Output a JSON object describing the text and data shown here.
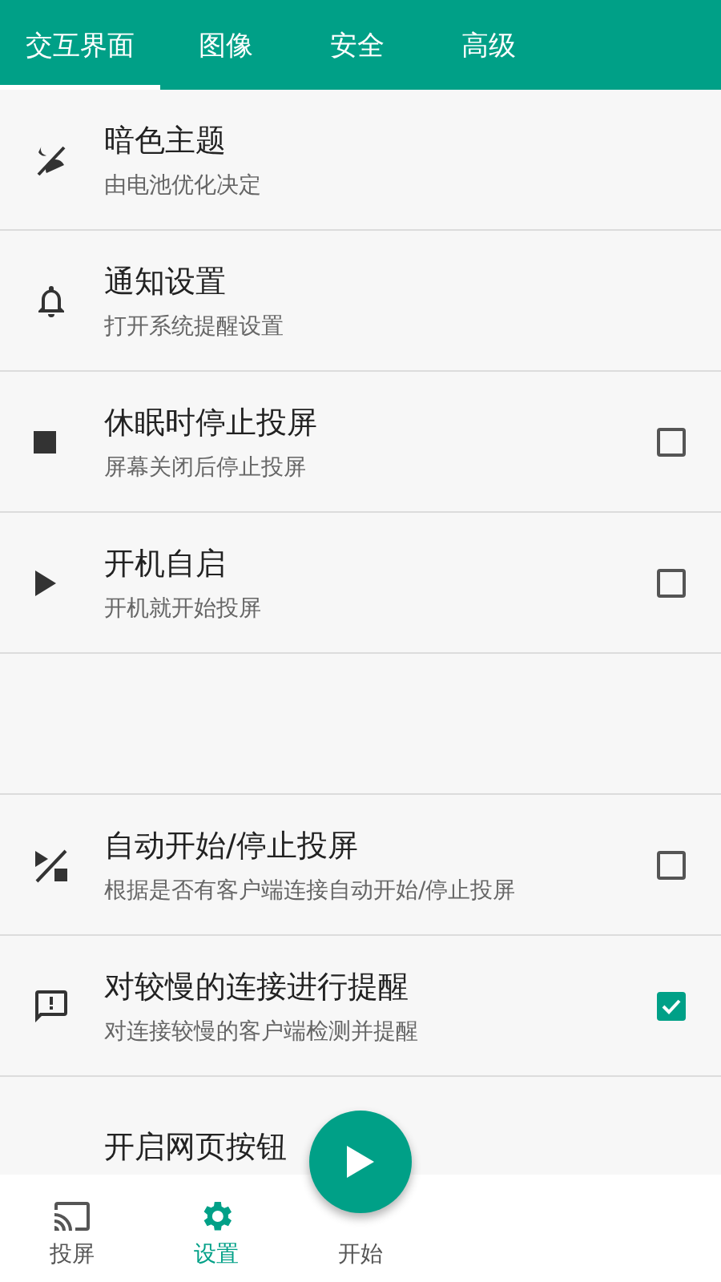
{
  "tabs": [
    {
      "label": "交互界面",
      "selected": true
    },
    {
      "label": "图像",
      "selected": false
    },
    {
      "label": "安全",
      "selected": false
    },
    {
      "label": "高级",
      "selected": false
    }
  ],
  "settings": [
    {
      "kind": "item",
      "title": "暗色主题",
      "subtitle": "由电池优化决定"
    },
    {
      "kind": "item",
      "title": "通知设置",
      "subtitle": "打开系统提醒设置"
    },
    {
      "kind": "checkbox",
      "title": "休眠时停止投屏",
      "subtitle": "屏幕关闭后停止投屏",
      "checked": false
    },
    {
      "kind": "checkbox",
      "title": "开机自启",
      "subtitle": "开机就开始投屏",
      "checked": false
    },
    {
      "kind": "blank"
    },
    {
      "kind": "checkbox",
      "title": "自动开始/停止投屏",
      "subtitle": "根据是否有客户端连接自动开始/停止投屏",
      "checked": false
    },
    {
      "kind": "checkbox",
      "title": "对较慢的连接进行提醒",
      "subtitle": "对连接较慢的客户端检测并提醒",
      "checked": true
    },
    {
      "kind": "item",
      "title": "开启网页按钮"
    }
  ],
  "bottom_nav": [
    {
      "label": "投屏",
      "selected": false
    },
    {
      "label": "设置",
      "selected": true
    },
    {
      "label": "开始",
      "selected": false
    }
  ]
}
